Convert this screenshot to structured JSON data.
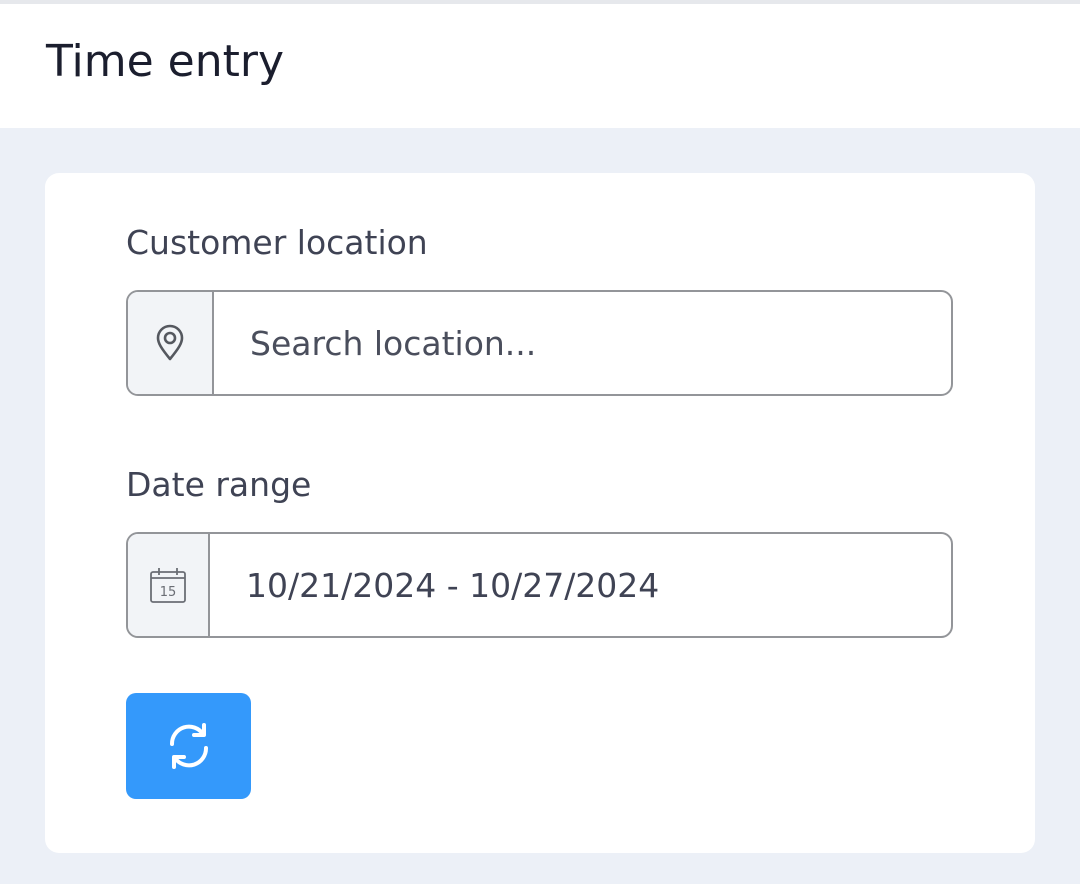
{
  "header": {
    "title": "Time entry"
  },
  "form": {
    "location": {
      "label": "Customer location",
      "placeholder": "Search location...",
      "value": "",
      "icon": "map-pin-icon"
    },
    "date_range": {
      "label": "Date range",
      "value": "10/21/2024 - 10/27/2024",
      "icon": "calendar-icon",
      "icon_day": "15"
    },
    "refresh": {
      "icon": "refresh-icon"
    }
  },
  "colors": {
    "background": "#ecf0f7",
    "card": "#ffffff",
    "accent": "#3499fb",
    "border": "#939599",
    "title": "#1b1e2e"
  }
}
